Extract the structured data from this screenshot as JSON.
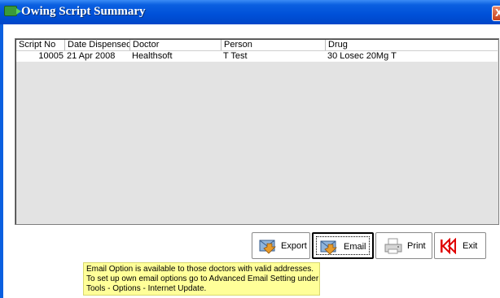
{
  "window": {
    "title": "Owing Script Summary",
    "close_glyph": "X"
  },
  "grid": {
    "columns": [
      "Script No",
      "Date Dispensed",
      "Doctor",
      "Person",
      "Drug"
    ],
    "rows": [
      {
        "script_no": "10005",
        "date_dispensed": "21 Apr 2008",
        "doctor": "Healthsoft",
        "person": "T Test",
        "drug": "30 Losec 20Mg T"
      }
    ]
  },
  "buttons": {
    "export": "Export",
    "email": "Email",
    "print": "Print",
    "exit": "Exit"
  },
  "note": {
    "lines": [
      "Email Option is available to those doctors with valid addresses.",
      "To set up own email options go to Advanced Email Setting under",
      "Tools - Options - Internet Update."
    ]
  },
  "colors": {
    "titlebar": "#0050d8",
    "note_background": "#ffff99",
    "exit_icon": "#e00000"
  },
  "icons": [
    "app-icon",
    "export-icon",
    "email-icon",
    "print-icon",
    "exit-icon",
    "close-icon"
  ]
}
